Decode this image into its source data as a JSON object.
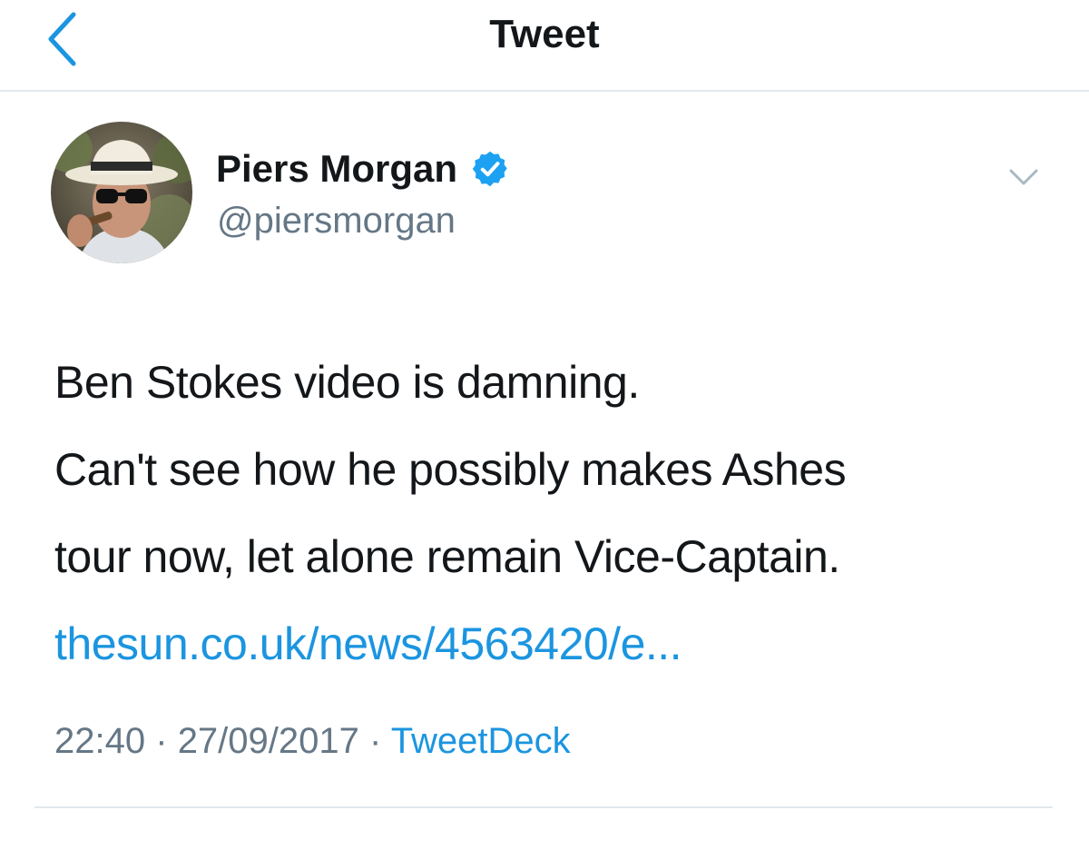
{
  "nav": {
    "title": "Tweet",
    "back_icon": "chevron-left-icon"
  },
  "tweet": {
    "author": {
      "name": "Piers Morgan",
      "handle": "@piersmorgan",
      "verified": true
    },
    "text_lines": [
      "Ben Stokes video is damning.",
      "Can't see how he possibly makes Ashes",
      "tour now, let alone remain Vice-Captain."
    ],
    "link": "thesun.co.uk/news/4563420/e...",
    "time": "22:40",
    "date": "27/09/2017",
    "separator": "·",
    "source": "TweetDeck"
  },
  "colors": {
    "accent": "#1b95e0",
    "text": "#14171a",
    "secondary": "#657786",
    "divider": "#e1e8ed",
    "verified_badge": "#1da1f2"
  }
}
